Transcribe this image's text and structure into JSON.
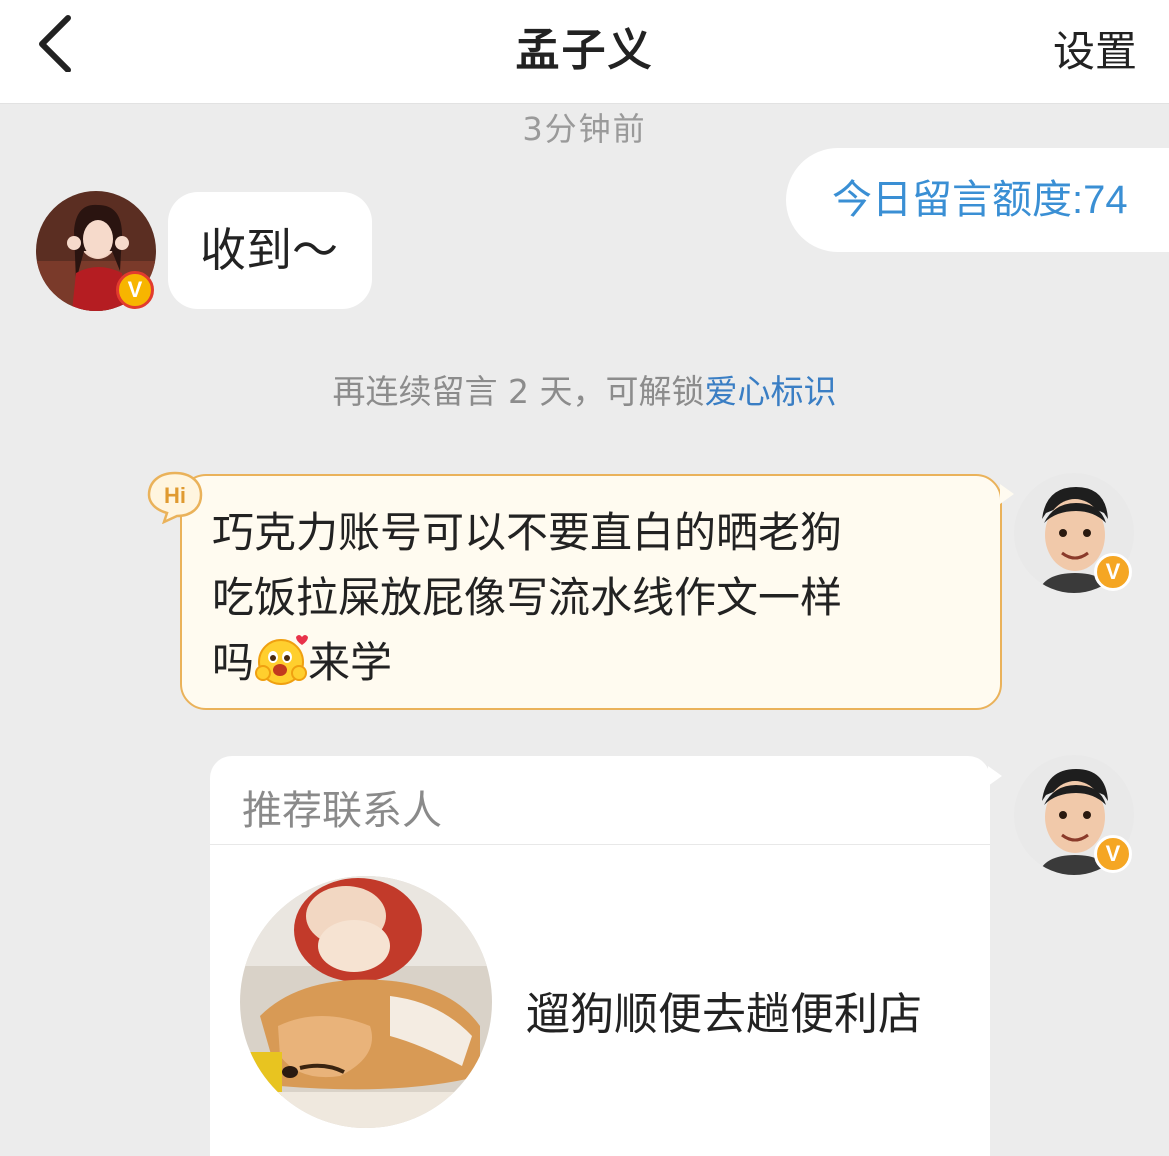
{
  "header": {
    "title": "孟子义",
    "settings_label": "设置",
    "back_icon": "chevron-left-icon"
  },
  "chat": {
    "timestamp": "3分钟前",
    "messages": [
      {
        "side": "left",
        "text": "收到～",
        "verified_badge": "V"
      },
      {
        "side": "right",
        "text": "今日留言额度:74"
      }
    ],
    "notice": {
      "prefix": "再连续留言 2 天，可解锁",
      "link": "爱心标识"
    },
    "hi_message": {
      "tag": "Hi",
      "line1": "巧克力账号可以不要直白的晒老狗",
      "line2": "吃饭拉屎放屁像写流水线作文一样",
      "line3_before": "吗",
      "line3_after": "来学",
      "emoji": "hug-face-emoji",
      "verified_badge": "V"
    },
    "contact_card": {
      "title": "推荐联系人",
      "name": "遛狗顺便去趟便利店",
      "verified_badge": "V"
    }
  },
  "colors": {
    "background": "#ececec",
    "accent_blue": "#3a8fd4",
    "hi_border": "#eab25a",
    "hi_fill": "#fffbf0",
    "badge_orange": "#f5a623"
  }
}
